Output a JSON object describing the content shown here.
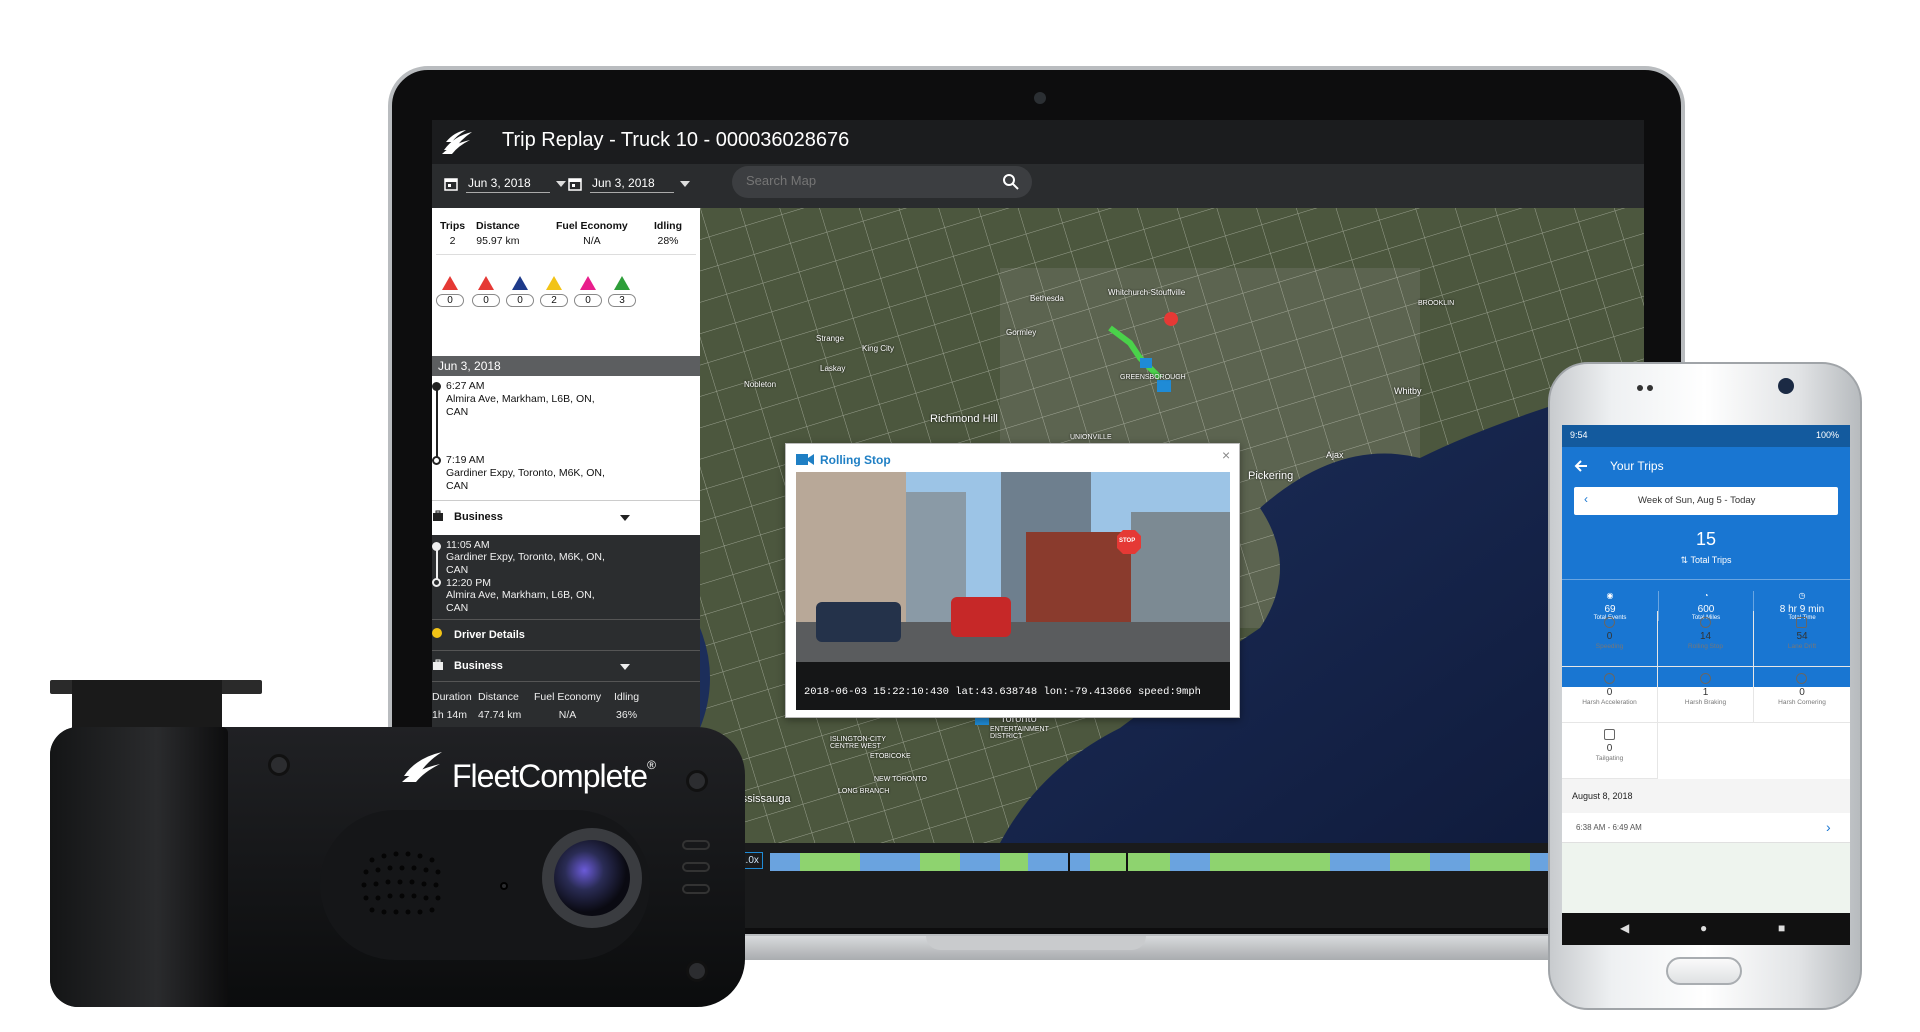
{
  "app": {
    "title": "Trip Replay - Truck 10 - 000036028676",
    "date_from": "Jun 3, 2018",
    "date_to": "Jun 3, 2018",
    "search_placeholder": "Search Map"
  },
  "summary": {
    "trips_label": "Trips",
    "trips_value": "2",
    "distance_label": "Distance",
    "distance_value": "95.97 km",
    "fuel_label": "Fuel Economy",
    "fuel_value": "N/A",
    "idling_label": "Idling",
    "idling_value": "28%"
  },
  "event_counts": [
    {
      "color": "#e53935",
      "value": "0"
    },
    {
      "color": "#e53935",
      "value": "0"
    },
    {
      "color": "#1e3a8a",
      "value": "0"
    },
    {
      "color": "#f2c316",
      "value": "2"
    },
    {
      "color": "#e91e8c",
      "value": "0"
    },
    {
      "color": "#2e9e3a",
      "value": "3"
    }
  ],
  "day_header": "Jun 3, 2018",
  "trip1": {
    "start_time": "6:27 AM",
    "start_addr": "Almira Ave, Markham, L6B, ON, CAN",
    "end_time": "7:19 AM",
    "end_addr": "Gardiner Expy, Toronto, M6K, ON, CAN",
    "category": "Business"
  },
  "trip2": {
    "start_time": "11:05 AM",
    "start_addr": "Gardiner Expy, Toronto, M6K, ON, CAN",
    "end_time": "12:20 PM",
    "end_addr": "Almira Ave, Markham, L6B, ON, CAN",
    "driver_details": "Driver Details",
    "category": "Business",
    "duration_label": "Duration",
    "duration_value": "1h 14m",
    "distance_label": "Distance",
    "distance_value": "47.74 km",
    "fuel_label": "Fuel Economy",
    "fuel_value": "N/A",
    "idling_label": "Idling",
    "idling_value": "36%"
  },
  "map_labels": {
    "richmond_hill": "Richmond Hill",
    "pickering": "Pickering",
    "toronto": "Toronto",
    "mississauga": "Mississauga",
    "ajax": "Ajax",
    "whitby": "Whitby",
    "king_city": "King City",
    "nobleton": "Nobleton",
    "bethesda": "Bethesda",
    "whitchurch": "Whitchurch-Stouffville",
    "gormley": "Gormley",
    "strange": "Strange",
    "laskay": "Laskay",
    "unionville": "UNIONVILLE",
    "greensborough": "GREENSBOROUGH",
    "brooklin": "BROOKLIN",
    "etobicoke": "ETOBICOKE",
    "islington": "ISLINGTON-CITY CENTRE WEST",
    "entertainment": "ENTERTAINMENT DISTRICT",
    "long_branch": "LONG BRANCH",
    "new_toronto": "NEW TORONTO"
  },
  "playback": {
    "speed": "1.0x"
  },
  "popup": {
    "title": "Rolling Stop",
    "close": "×",
    "overlay": "2018-06-03 15:22:10:430 lat:43.638748 lon:-79.413666 speed:9mph",
    "stop_sign": "STOP"
  },
  "dashcam": {
    "brand_part1": "Fleet",
    "brand_part2": "Complete",
    "reg": "®"
  },
  "phone": {
    "status_time": "9:54",
    "status_right": "100%",
    "title": "Your Trips",
    "week": "Week of Sun, Aug 5 - Today",
    "total_trips_value": "15",
    "total_trips_label": "Total Trips",
    "top_stats": [
      {
        "value": "69",
        "label": "Total Events"
      },
      {
        "value": "600",
        "label": "Total Miles"
      },
      {
        "value": "8 hr 9 min",
        "label": "Total Time"
      }
    ],
    "grid": [
      {
        "value": "0",
        "label": "Speeding"
      },
      {
        "value": "14",
        "label": "Rolling Stop"
      },
      {
        "value": "54",
        "label": "Lane Drift"
      },
      {
        "value": "0",
        "label": "Harsh Acceleration"
      },
      {
        "value": "1",
        "label": "Harsh Braking"
      },
      {
        "value": "0",
        "label": "Harsh Cornering"
      },
      {
        "value": "0",
        "label": "Tailgating"
      }
    ],
    "section_date": "August 8, 2018",
    "trip_row": "6:38 AM - 6:49 AM"
  }
}
